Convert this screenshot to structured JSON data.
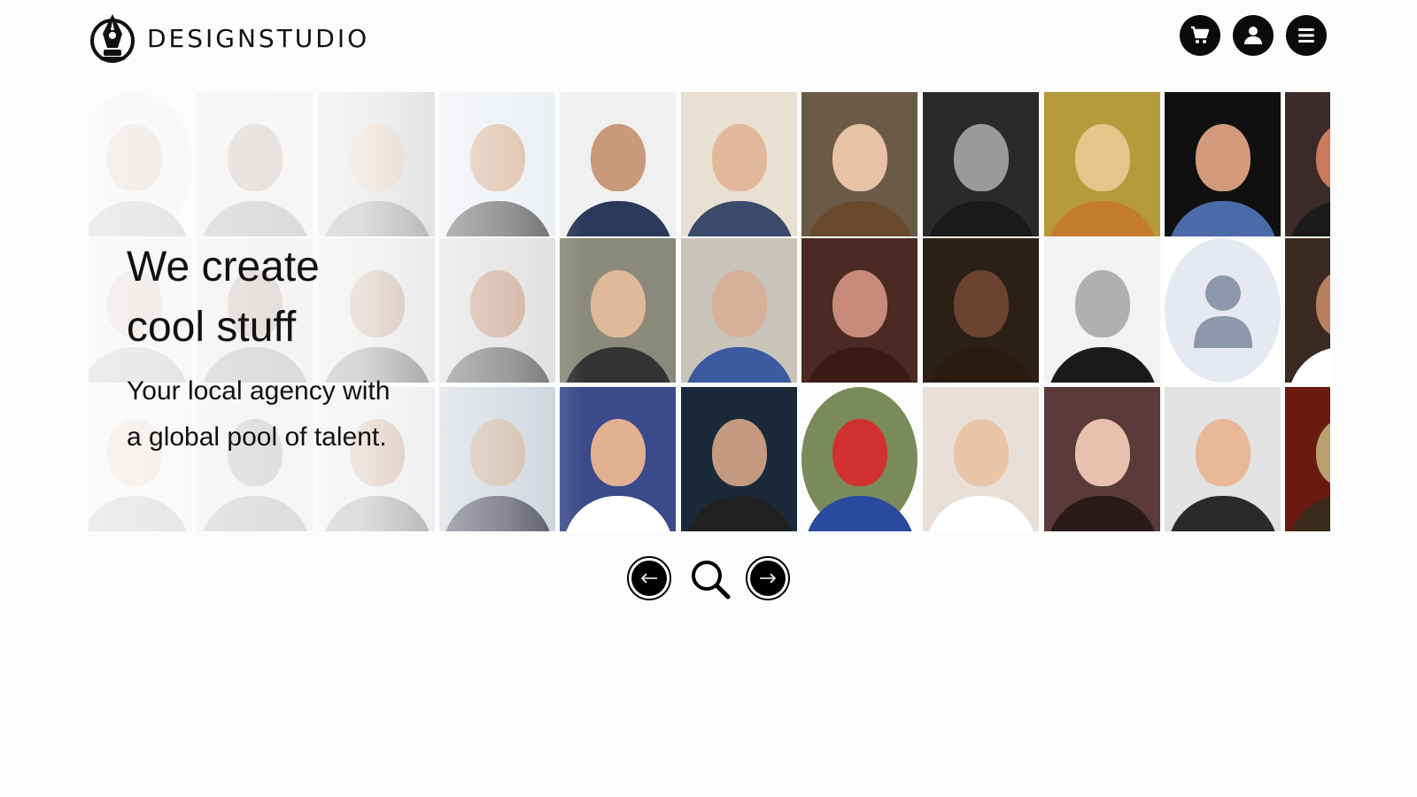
{
  "brand": {
    "name": "DESIGNSTUDIO",
    "logo_icon": "pen-nib-logo-icon"
  },
  "header": {
    "actions": [
      {
        "name": "cart",
        "icon": "cart-icon"
      },
      {
        "name": "account",
        "icon": "user-icon"
      },
      {
        "name": "menu",
        "icon": "hamburger-menu-icon"
      }
    ]
  },
  "hero": {
    "title_line1": "We create",
    "title_line2": "cool stuff",
    "subtitle_line1": "Your local agency with",
    "subtitle_line2": "a global pool of talent."
  },
  "gallery": {
    "description": "grid of designer profile photos",
    "placeholder_icon": "user-placeholder-icon"
  },
  "controls": {
    "prev_icon": "arrow-left-icon",
    "search_icon": "search-icon",
    "next_icon": "arrow-right-icon"
  },
  "colors": {
    "accent": "#0b0b0b",
    "background": "#fcfcfc",
    "placeholder": "#e6e9f2",
    "placeholder_icon": "#8f97ad"
  }
}
